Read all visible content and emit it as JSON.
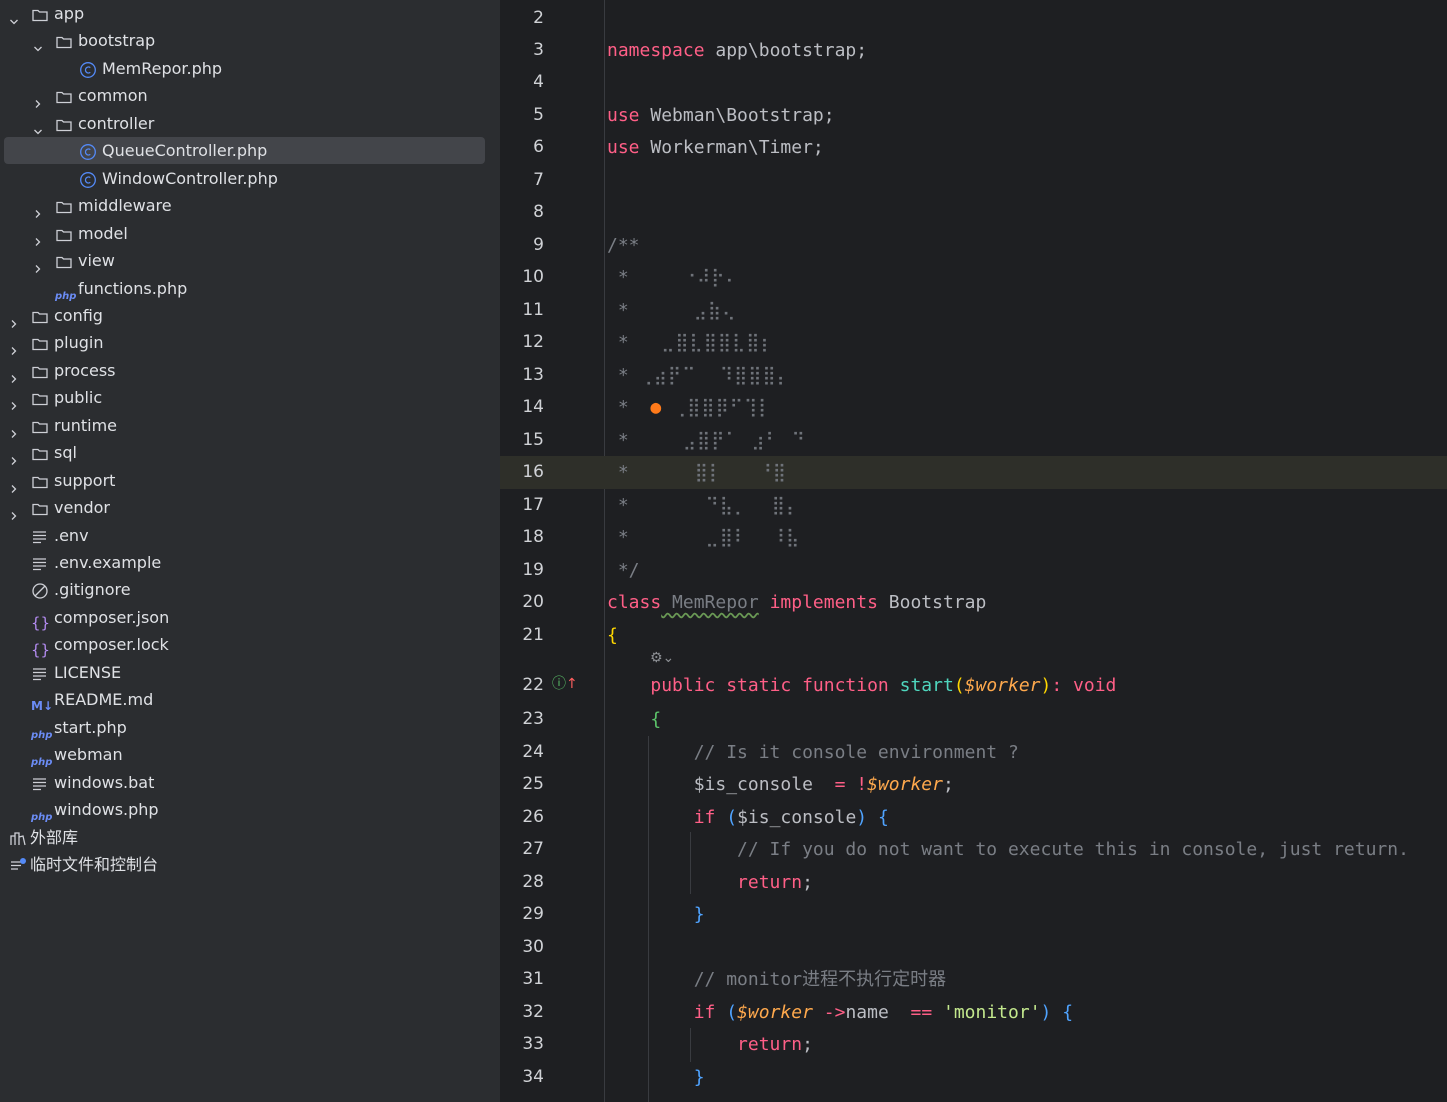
{
  "tree": [
    {
      "label": "app",
      "level": 0,
      "kind": "folder",
      "expanded": true
    },
    {
      "label": "bootstrap",
      "level": 1,
      "kind": "folder",
      "expanded": true
    },
    {
      "label": "MemRepor.php",
      "level": 2,
      "kind": "class"
    },
    {
      "label": "common",
      "level": 1,
      "kind": "folder",
      "expanded": false
    },
    {
      "label": "controller",
      "level": 1,
      "kind": "folder",
      "expanded": true
    },
    {
      "label": "QueueController.php",
      "level": 2,
      "kind": "class",
      "selected": true
    },
    {
      "label": "WindowController.php",
      "level": 2,
      "kind": "class"
    },
    {
      "label": "middleware",
      "level": 1,
      "kind": "folder",
      "expanded": false
    },
    {
      "label": "model",
      "level": 1,
      "kind": "folder",
      "expanded": false
    },
    {
      "label": "view",
      "level": 1,
      "kind": "folder",
      "expanded": false
    },
    {
      "label": "functions.php",
      "level": 1,
      "kind": "php"
    },
    {
      "label": "config",
      "level": 0,
      "kind": "folder",
      "expanded": false
    },
    {
      "label": "plugin",
      "level": 0,
      "kind": "folder",
      "expanded": false
    },
    {
      "label": "process",
      "level": 0,
      "kind": "folder",
      "expanded": false
    },
    {
      "label": "public",
      "level": 0,
      "kind": "folder",
      "expanded": false
    },
    {
      "label": "runtime",
      "level": 0,
      "kind": "folder",
      "expanded": false
    },
    {
      "label": "sql",
      "level": 0,
      "kind": "folder",
      "expanded": false
    },
    {
      "label": "support",
      "level": 0,
      "kind": "folder",
      "expanded": false
    },
    {
      "label": "vendor",
      "level": 0,
      "kind": "folder",
      "expanded": false
    },
    {
      "label": ".env",
      "level": 0,
      "kind": "text"
    },
    {
      "label": ".env.example",
      "level": 0,
      "kind": "text"
    },
    {
      "label": ".gitignore",
      "level": 0,
      "kind": "ignore"
    },
    {
      "label": "composer.json",
      "level": 0,
      "kind": "json"
    },
    {
      "label": "composer.lock",
      "level": 0,
      "kind": "json"
    },
    {
      "label": "LICENSE",
      "level": 0,
      "kind": "text"
    },
    {
      "label": "README.md",
      "level": 0,
      "kind": "md"
    },
    {
      "label": "start.php",
      "level": 0,
      "kind": "php"
    },
    {
      "label": "webman",
      "level": 0,
      "kind": "php"
    },
    {
      "label": "windows.bat",
      "level": 0,
      "kind": "text"
    },
    {
      "label": "windows.php",
      "level": 0,
      "kind": "php"
    },
    {
      "label": "外部库",
      "level": -1,
      "kind": "library"
    },
    {
      "label": "临时文件和控制台",
      "level": -1,
      "kind": "scratch"
    }
  ],
  "editor": {
    "highlighted_line": 16,
    "lines": [
      {
        "n": "2",
        "parts": []
      },
      {
        "n": "3",
        "parts": [
          [
            "kw",
            "namespace"
          ],
          [
            "",
            "app\\bootstrap;"
          ]
        ]
      },
      {
        "n": "4",
        "parts": []
      },
      {
        "n": "5",
        "parts": [
          [
            "kw",
            "use"
          ],
          [
            "",
            "Webman\\Bootstrap;"
          ]
        ]
      },
      {
        "n": "6",
        "parts": [
          [
            "kw",
            "use"
          ],
          [
            "",
            "Workerman\\Timer;"
          ]
        ]
      },
      {
        "n": "7",
        "parts": []
      },
      {
        "n": "8",
        "parts": []
      },
      {
        "n": "9",
        "parts": [
          [
            "cm",
            "/**"
          ]
        ]
      },
      {
        "n": "10",
        "parts": [
          [
            "cm",
            " *     "
          ],
          [
            "dots",
            "⠐⠼⡗⠄"
          ]
        ]
      },
      {
        "n": "11",
        "parts": [
          [
            "cm",
            " *      "
          ],
          [
            "dots",
            "⣠⣷⢄"
          ]
        ]
      },
      {
        "n": "12",
        "parts": [
          [
            "cm",
            " *   "
          ],
          [
            "dots",
            "⣀⣿⣇⣿⣿⣇⣿⡆"
          ]
        ]
      },
      {
        "n": "13",
        "parts": [
          [
            "cm",
            " * "
          ],
          [
            "dots",
            "⢀⣴⡟⠉  ⠹⣿⣿⣿⡄"
          ]
        ]
      },
      {
        "n": "14",
        "parts": [
          [
            "cm",
            " *  "
          ],
          [
            "ball",
            "🏀"
          ],
          [
            "dots",
            " ⢀⣿⣿⡿⠋⢹⡇"
          ]
        ]
      },
      {
        "n": "15",
        "parts": [
          [
            "cm",
            " *     "
          ],
          [
            "dots",
            "⣠⣿⡟⠁ ⣰⠃ ⠙"
          ]
        ]
      },
      {
        "n": "16",
        "parts": [
          [
            "cm",
            " *     "
          ],
          [
            "dots",
            " ⣿⡇   ⠘⣿"
          ]
        ]
      },
      {
        "n": "17",
        "parts": [
          [
            "cm",
            " *      "
          ],
          [
            "dots",
            " ⠙⣧⡀  ⣿⡄"
          ]
        ]
      },
      {
        "n": "18",
        "parts": [
          [
            "cm",
            " *      "
          ],
          [
            "dots",
            " ⣀⣿⠇  ⠸⣧"
          ]
        ]
      },
      {
        "n": "19",
        "parts": [
          [
            "cm",
            " */"
          ]
        ]
      },
      {
        "n": "20",
        "parts": [
          [
            "kw",
            "class"
          ],
          [
            "cls",
            "MemRepor"
          ],
          [
            "kw",
            "implements"
          ],
          [
            "",
            "Bootstrap"
          ]
        ]
      },
      {
        "n": "21",
        "parts": [
          [
            "br1",
            "{"
          ]
        ]
      },
      {
        "n": "22",
        "parts": [
          [
            "",
            "    "
          ],
          [
            "kw",
            "public static function"
          ],
          [
            "fn",
            "start"
          ],
          [
            "br1",
            "("
          ],
          [
            "vi",
            "$worker"
          ],
          [
            "br1",
            ")"
          ],
          [
            "kw",
            ": void"
          ]
        ]
      },
      {
        "n": "23",
        "parts": [
          [
            "",
            "    "
          ],
          [
            "br2",
            "{"
          ]
        ]
      },
      {
        "n": "24",
        "parts": [
          [
            "",
            "        "
          ],
          [
            "cm",
            "// Is it console environment ?"
          ]
        ]
      },
      {
        "n": "25",
        "parts": [
          [
            "",
            "        $is_console "
          ],
          [
            "kw",
            "= !"
          ],
          [
            "vi",
            "$worker"
          ],
          [
            "",
            ";"
          ]
        ]
      },
      {
        "n": "26",
        "parts": [
          [
            "",
            "        "
          ],
          [
            "kw",
            "if"
          ],
          [
            "br3",
            " ("
          ],
          [
            "",
            "$is_console"
          ],
          [
            "br3",
            ")"
          ],
          [
            "br3",
            " {"
          ]
        ]
      },
      {
        "n": "27",
        "parts": [
          [
            "",
            "            "
          ],
          [
            "cm",
            "// If you do not want to execute this in console, just return."
          ]
        ]
      },
      {
        "n": "28",
        "parts": [
          [
            "",
            "            "
          ],
          [
            "kw",
            "return"
          ],
          [
            "",
            ";"
          ]
        ]
      },
      {
        "n": "29",
        "parts": [
          [
            "",
            "        "
          ],
          [
            "br3",
            "}"
          ]
        ]
      },
      {
        "n": "30",
        "parts": []
      },
      {
        "n": "31",
        "parts": [
          [
            "",
            "        "
          ],
          [
            "cm",
            "// monitor进程不执行定时器"
          ]
        ]
      },
      {
        "n": "32",
        "parts": [
          [
            "",
            "        "
          ],
          [
            "kw",
            "if"
          ],
          [
            "br3",
            " ("
          ],
          [
            "vi",
            "$worker"
          ],
          [
            "kw",
            "->"
          ],
          [
            "",
            "name "
          ],
          [
            "kw",
            "=="
          ],
          [
            "str",
            " 'monitor'"
          ],
          [
            "br3",
            ")"
          ],
          [
            "br3",
            " {"
          ]
        ]
      },
      {
        "n": "33",
        "parts": [
          [
            "",
            "            "
          ],
          [
            "kw",
            "return"
          ],
          [
            "",
            ";"
          ]
        ]
      },
      {
        "n": "34",
        "parts": [
          [
            "",
            "        "
          ],
          [
            "br3",
            "}"
          ]
        ]
      }
    ]
  }
}
